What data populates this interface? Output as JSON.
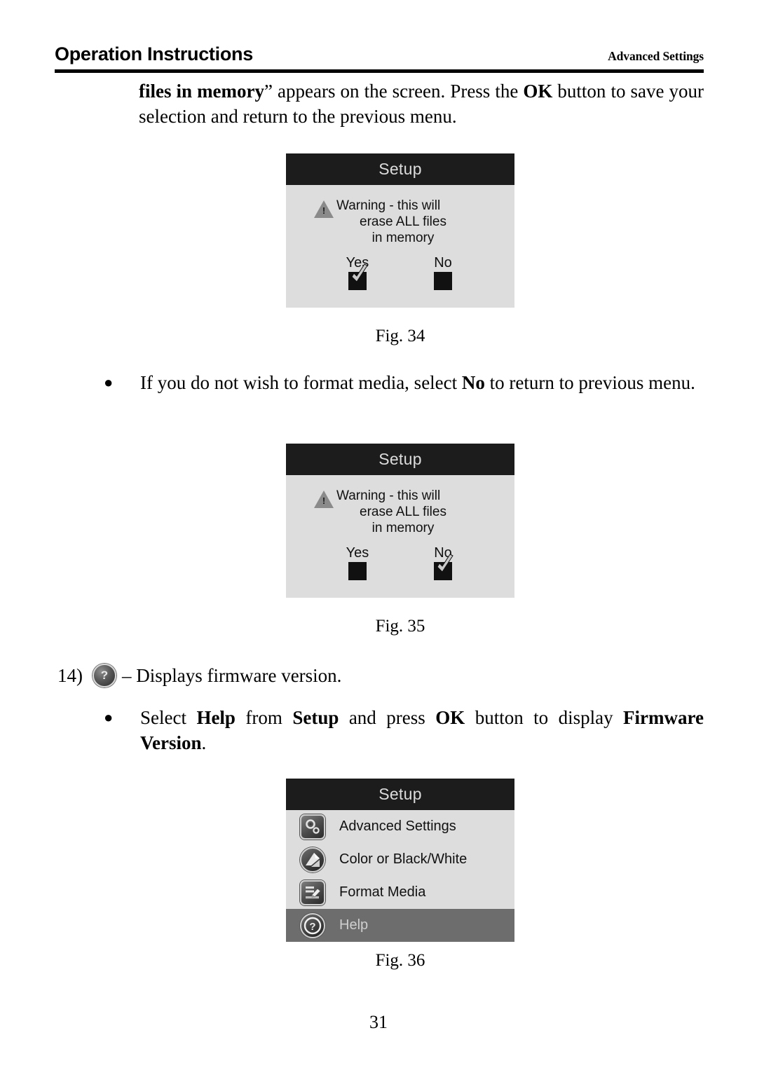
{
  "header": {
    "left_title": "Operation Instructions",
    "right_title": "Advanced Settings"
  },
  "intro_paragraph": {
    "bold_lead": "files in memory",
    "quote_mark": "”",
    "text_after": " appears on the screen. Press the ",
    "bold_ok": "OK",
    "text_tail": " button to save your selection and return to the previous menu."
  },
  "bullets": [
    {
      "marker": "●",
      "part1": "If you do not wish to format media, select ",
      "bold": "No",
      "part2": " to return to previous menu."
    },
    {
      "marker": "●",
      "part1": "Select ",
      "bold1": "Help",
      "part2": " from ",
      "bold2": "Setup",
      "part3": " and press ",
      "bold3": "OK",
      "part4": " button to display ",
      "bold4": "Firmware Version",
      "part5": "."
    }
  ],
  "numbered_item": {
    "number": "14)",
    "icon": "help-circle-icon",
    "text": "– Displays firmware version."
  },
  "figures": [
    {
      "id": "fig34",
      "caption": "Fig. 34",
      "screen_title": "Setup",
      "warning_icon": "warning-triangle-icon",
      "warning_lines": [
        "Warning - this will",
        "erase ALL files",
        "in memory"
      ],
      "choices": [
        {
          "label": "Yes",
          "checked": true
        },
        {
          "label": "No",
          "checked": false
        }
      ]
    },
    {
      "id": "fig35",
      "caption": "Fig. 35",
      "screen_title": "Setup",
      "warning_icon": "warning-triangle-icon",
      "warning_lines": [
        "Warning - this will",
        "erase ALL files",
        "in memory"
      ],
      "choices": [
        {
          "label": "Yes",
          "checked": false
        },
        {
          "label": "No",
          "checked": true
        }
      ]
    },
    {
      "id": "fig36",
      "caption": "Fig. 36",
      "screen_title": "Setup",
      "menu_items": [
        {
          "label": "Advanced Settings",
          "icon": "gears-icon",
          "selected": false
        },
        {
          "label": "Color or Black/White",
          "icon": "color-bw-circle-icon",
          "selected": false
        },
        {
          "label": "Format Media",
          "icon": "format-media-icon",
          "selected": false
        },
        {
          "label": "Help",
          "icon": "help-circle-icon",
          "selected": true
        }
      ]
    }
  ],
  "page_number": "31",
  "colors": {
    "screen_background": "#dddddd",
    "screen_titlebar": "#1c1c1c",
    "selected_row": "#6d6d6d",
    "selected_row_text": "#cfcfcf",
    "ink": "#000000"
  }
}
